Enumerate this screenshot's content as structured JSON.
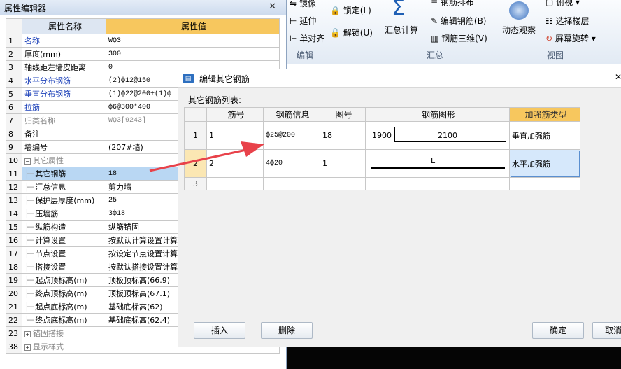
{
  "prop_editor": {
    "title": "属性编辑器",
    "close": "✕",
    "header": {
      "name": "属性名称",
      "value": "属性值"
    },
    "rows": [
      {
        "num": "1",
        "name": "名称",
        "value": "WQ3"
      },
      {
        "num": "2",
        "name": "厚度(mm)",
        "value": "300"
      },
      {
        "num": "3",
        "name": "轴线距左墙皮距离",
        "value": "0"
      },
      {
        "num": "4",
        "name": "水平分布钢筋",
        "value": "(2)ф12@150"
      },
      {
        "num": "5",
        "name": "垂直分布钢筋",
        "value": "(1)ф22@200+(1)ф"
      },
      {
        "num": "6",
        "name": "拉筋",
        "value": "ф6@300*400"
      },
      {
        "num": "7",
        "name": "归类名称",
        "value": "WQ3[9243]"
      },
      {
        "num": "8",
        "name": "备注",
        "value": ""
      },
      {
        "num": "9",
        "name": "墙编号",
        "value": "(207#墙)"
      },
      {
        "num": "10",
        "name": "其它属性",
        "value": ""
      },
      {
        "num": "11",
        "name": "其它钢筋",
        "value": "18"
      },
      {
        "num": "12",
        "name": "汇总信息",
        "value": "剪力墙"
      },
      {
        "num": "13",
        "name": "保护层厚度(mm)",
        "value": "25"
      },
      {
        "num": "14",
        "name": "压墙筋",
        "value": "3ф18"
      },
      {
        "num": "15",
        "name": "纵筋构造",
        "value": "纵筋锚固"
      },
      {
        "num": "16",
        "name": "计算设置",
        "value": "按默认计算设置计算"
      },
      {
        "num": "17",
        "name": "节点设置",
        "value": "按设定节点设置计算"
      },
      {
        "num": "18",
        "name": "搭接设置",
        "value": "按默认搭接设置计算"
      },
      {
        "num": "19",
        "name": "起点顶标高(m)",
        "value": "顶板顶标高(66.9)"
      },
      {
        "num": "20",
        "name": "终点顶标高(m)",
        "value": "顶板顶标高(67.1)"
      },
      {
        "num": "21",
        "name": "起点底标高(m)",
        "value": "基础底标高(62)"
      },
      {
        "num": "22",
        "name": "终点底标高(m)",
        "value": "基础底标高(62.4)"
      },
      {
        "num": "23",
        "name": "锚固搭接",
        "value": ""
      },
      {
        "num": "38",
        "name": "显示样式",
        "value": ""
      }
    ]
  },
  "ribbon": {
    "mirror": "镜像",
    "extend": "延伸",
    "align": "单对齐",
    "lock": "锁定(L)",
    "unlock": "解锁(U)",
    "group_edit": "编辑",
    "sum_calc": "汇总计算",
    "rebar_layout": "钢筋排布",
    "edit_rebar": "编辑钢筋(B)",
    "rebar_3d": "钢筋三维(V)",
    "group_sum": "汇总",
    "dynamic_view": "动态观察",
    "top_view": "俯视",
    "select_floor": "选择楼层",
    "screen_rotate": "屏幕旋转",
    "group_view": "视图"
  },
  "dialog": {
    "title": "编辑其它钢筋",
    "subtitle": "其它钢筋列表:",
    "columns": [
      "筋号",
      "钢筋信息",
      "图号",
      "钢筋图形",
      "加强筋类型"
    ],
    "rows": [
      {
        "num": "1",
        "bar": "1",
        "info": "ф25@200",
        "fig": "18",
        "dim_left": "1900",
        "dim_mid": "2100",
        "type": "垂直加强筋"
      },
      {
        "num": "2",
        "bar": "2",
        "info": "4ф20",
        "fig": "1",
        "shape_label": "L",
        "type": "水平加强筋"
      },
      {
        "num": "3",
        "bar": "",
        "info": "",
        "fig": "",
        "type": ""
      }
    ],
    "btn_insert": "插入",
    "btn_delete": "删除",
    "btn_ok": "确定",
    "btn_cancel": "取消",
    "close": "✕"
  },
  "colors": {
    "accent_header": "#f7c75e",
    "selected_row": "#b9d7f3",
    "arrow": "#e8424a"
  }
}
